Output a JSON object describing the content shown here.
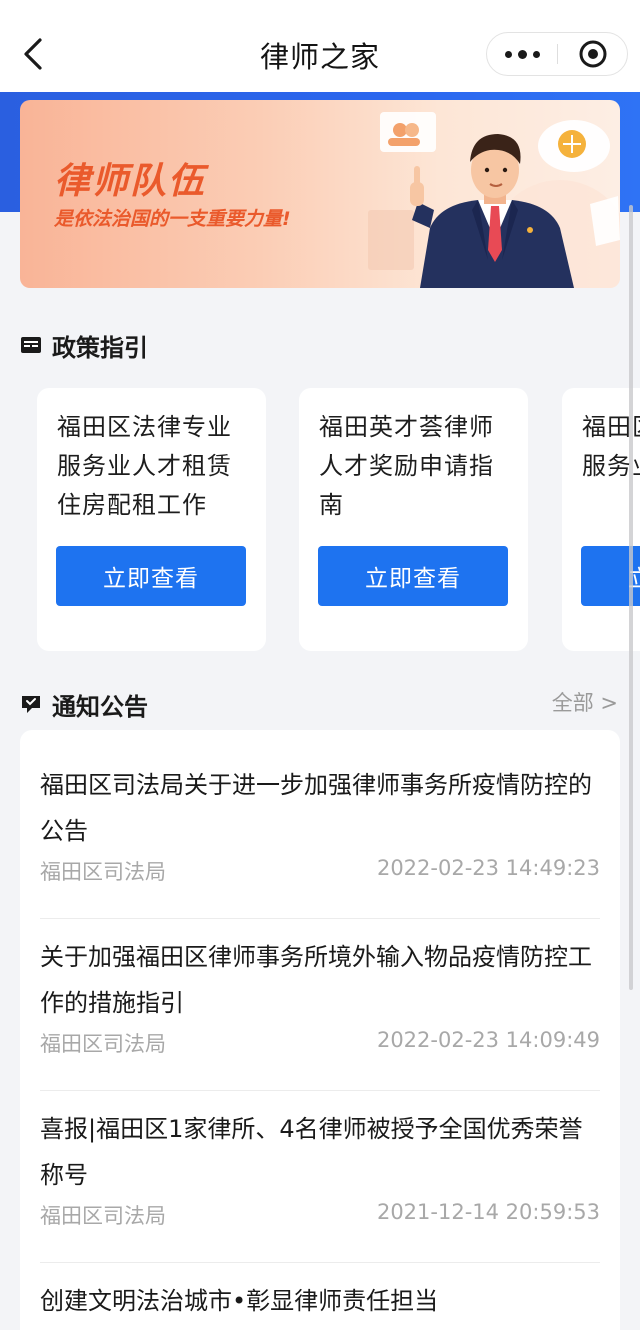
{
  "nav": {
    "title": "律师之家"
  },
  "banner": {
    "title": "律师队伍",
    "subtitle": "是依法治国的一支重要力量!"
  },
  "policy": {
    "section_title": "政策指引",
    "cards": [
      {
        "text": "福田区法律专业服务业人才租赁住房配租工作",
        "button": "立即查看"
      },
      {
        "text": "福田英才荟律师人才奖励申请指南",
        "button": "立即查看"
      },
      {
        "text": "福田区法律专业服务业政策",
        "button": "立即查看"
      }
    ]
  },
  "notices": {
    "section_title": "通知公告",
    "see_all": "全部 >",
    "items": [
      {
        "title": "福田区司法局关于进一步加强律师事务所疫情防控的公告",
        "source": "福田区司法局",
        "time": "2022-02-23 14:49:23"
      },
      {
        "title": "关于加强福田区律师事务所境外输入物品疫情防控工作的措施指引",
        "source": "福田区司法局",
        "time": "2022-02-23 14:09:49"
      },
      {
        "title": "喜报|福田区1家律所、4名律师被授予全国优秀荣誉称号",
        "source": "福田区司法局",
        "time": "2021-12-14 20:59:53"
      },
      {
        "title": "创建文明法治城市•彰显律师责任担当",
        "source": "",
        "time": ""
      }
    ]
  },
  "colors": {
    "accent_blue": "#1e73f0",
    "banner_text": "#ea5a2c",
    "header_blue": "#2a66ee"
  },
  "icons": {
    "back": "chevron-left-icon",
    "more": "more-dots-icon",
    "close": "target-close-icon",
    "policy": "document-icon",
    "notice": "message-icon"
  }
}
